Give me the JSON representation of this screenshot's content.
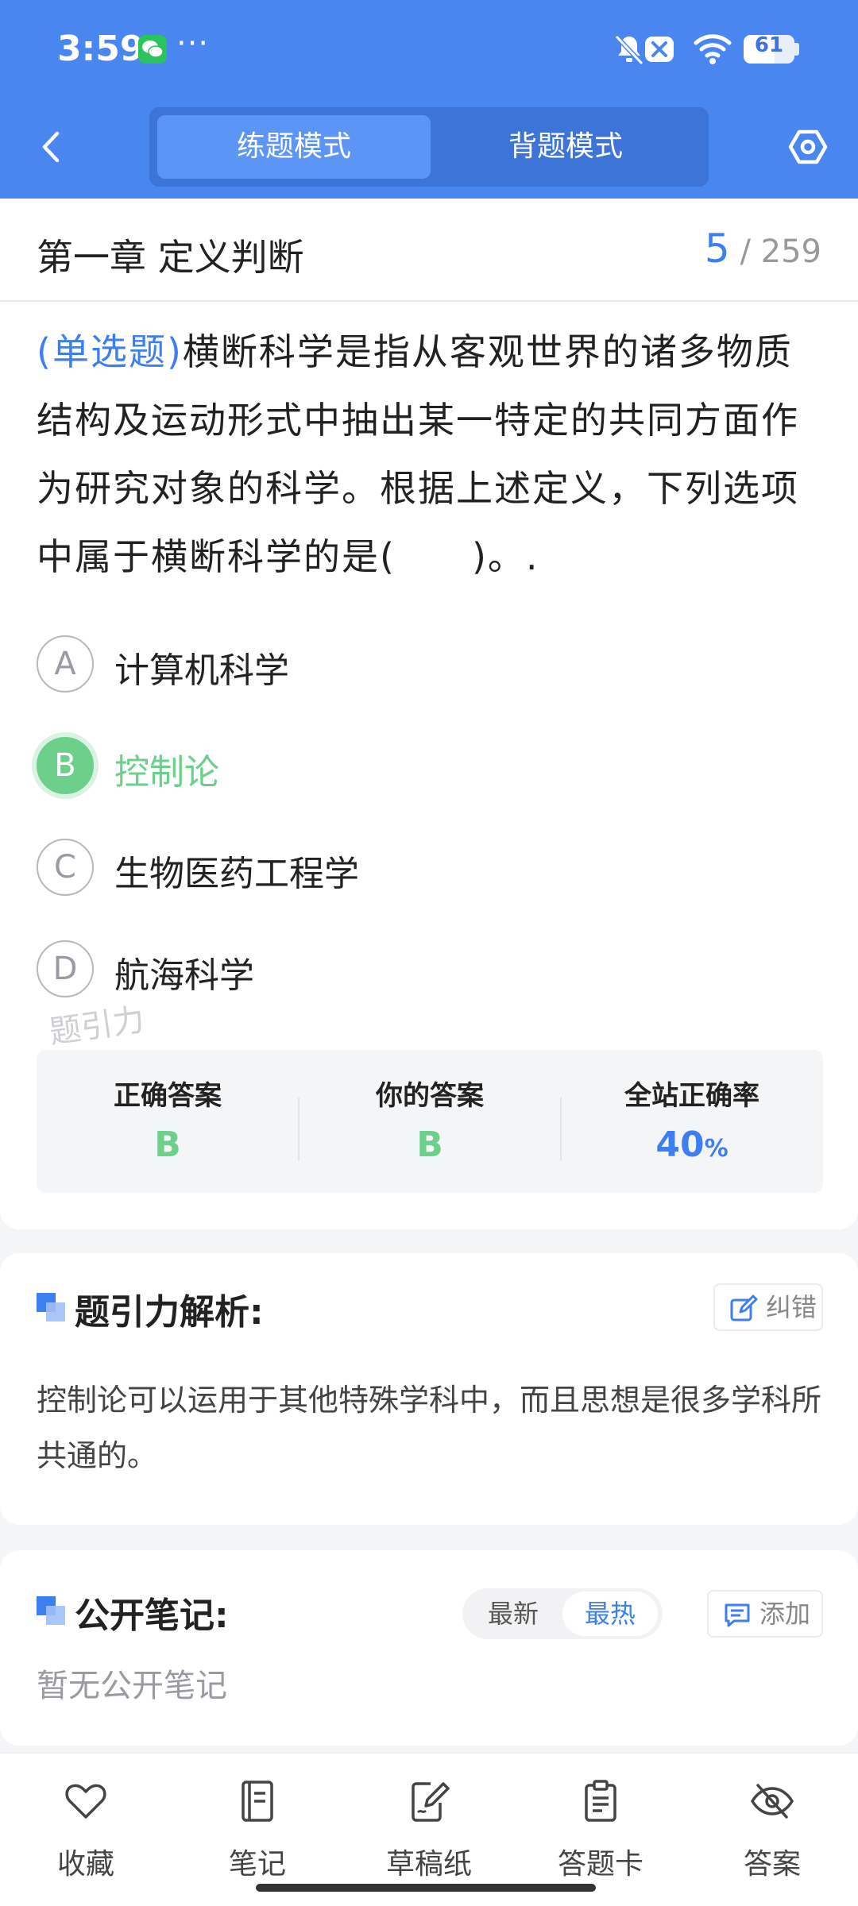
{
  "status_bar": {
    "time": "3:59",
    "overflow": "···",
    "battery": "61",
    "battery_level": 0.61
  },
  "header": {
    "tabs": [
      {
        "label": "练题模式",
        "active": true
      },
      {
        "label": "背题模式",
        "active": false
      }
    ]
  },
  "chapter": {
    "title": "第一章 定义判断",
    "current": "5",
    "total": "/ 259"
  },
  "question": {
    "type_label": "(单选题)",
    "text": "横断科学是指从客观世界的诸多物质结构及运动形式中抽出某一特定的共同方面作为研究对象的科学。根据上述定义，下列选项中属于横断科学的是(　　)。.",
    "options": [
      {
        "letter": "A",
        "text": "计算机科学"
      },
      {
        "letter": "B",
        "text": "控制论"
      },
      {
        "letter": "C",
        "text": "生物医药工程学"
      },
      {
        "letter": "D",
        "text": "航海科学"
      }
    ]
  },
  "watermark": "题引力",
  "stats": {
    "correct_label": "正确答案",
    "correct_value": "B",
    "yours_label": "你的答案",
    "yours_value": "B",
    "rate_label": "全站正确率",
    "rate_value": "40",
    "rate_unit": "%"
  },
  "analysis": {
    "title": "题引力解析:",
    "report_label": "纠错",
    "text": "控制论可以运用于其他特殊学科中，而且思想是很多学科所共通的。"
  },
  "notes": {
    "title": "公开笔记:",
    "sort_latest": "最新",
    "sort_hottest": "最热",
    "add_label": "添加",
    "empty": "暂无公开笔记"
  },
  "bottom_nav": [
    {
      "label": "收藏",
      "icon": "heart-icon"
    },
    {
      "label": "笔记",
      "icon": "notebook-icon"
    },
    {
      "label": "草稿纸",
      "icon": "draft-icon"
    },
    {
      "label": "答题卡",
      "icon": "clipboard-icon"
    },
    {
      "label": "答案",
      "icon": "eye-off-icon"
    }
  ],
  "colors": {
    "brand": "#4a86f0",
    "accent_blue": "#3d7ff0",
    "correct_green": "#6ccf8a"
  }
}
